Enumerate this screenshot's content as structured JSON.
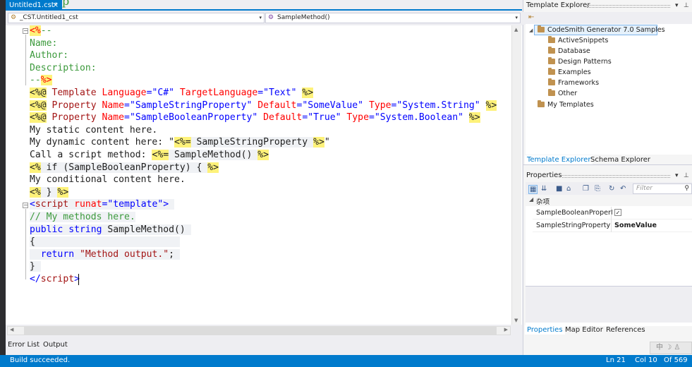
{
  "document_tab": {
    "title": "Untitled1.cst*",
    "close": "×"
  },
  "background_fragment": "p",
  "navbar": {
    "left": {
      "icon": "class-icon",
      "value": "_CST.Untitled1_cst"
    },
    "right": {
      "icon": "method-icon",
      "value": "SampleMethod()"
    },
    "arrow": "▾"
  },
  "code_lines": [
    [
      {
        "t": "<%",
        "c": "hl r"
      },
      {
        "t": "--",
        "c": "g"
      }
    ],
    [
      {
        "t": "Name:",
        "c": "g"
      }
    ],
    [
      {
        "t": "Author:",
        "c": "g"
      }
    ],
    [
      {
        "t": "Description:",
        "c": "g"
      }
    ],
    [
      {
        "t": "--",
        "c": "g"
      },
      {
        "t": "%>",
        "c": "hl r"
      }
    ],
    [
      {
        "t": "<%@",
        "c": "hl t"
      },
      {
        "t": " Template ",
        "c": "m"
      },
      {
        "t": "Language",
        "c": "r"
      },
      {
        "t": "=",
        "c": "b"
      },
      {
        "t": "\"C#\"",
        "c": "b"
      },
      {
        "t": " TargetLanguage",
        "c": "r"
      },
      {
        "t": "=",
        "c": "b"
      },
      {
        "t": "\"Text\"",
        "c": "b"
      },
      {
        "t": " ",
        "c": "t"
      },
      {
        "t": "%>",
        "c": "hl t"
      }
    ],
    [
      {
        "t": "<%@",
        "c": "hl t"
      },
      {
        "t": " Property ",
        "c": "m"
      },
      {
        "t": "Name",
        "c": "r"
      },
      {
        "t": "=",
        "c": "b"
      },
      {
        "t": "\"SampleStringProperty\"",
        "c": "b"
      },
      {
        "t": " Default",
        "c": "r"
      },
      {
        "t": "=",
        "c": "b"
      },
      {
        "t": "\"SomeValue\"",
        "c": "b"
      },
      {
        "t": " Type",
        "c": "r"
      },
      {
        "t": "=",
        "c": "b"
      },
      {
        "t": "\"System.String\"",
        "c": "b"
      },
      {
        "t": " ",
        "c": "t"
      },
      {
        "t": "%>",
        "c": "hl t"
      }
    ],
    [
      {
        "t": "<%@",
        "c": "hl t"
      },
      {
        "t": " Property ",
        "c": "m"
      },
      {
        "t": "Name",
        "c": "r"
      },
      {
        "t": "=",
        "c": "b"
      },
      {
        "t": "\"SampleBooleanProperty\"",
        "c": "b"
      },
      {
        "t": " Default",
        "c": "r"
      },
      {
        "t": "=",
        "c": "b"
      },
      {
        "t": "\"True\"",
        "c": "b"
      },
      {
        "t": " Type",
        "c": "r"
      },
      {
        "t": "=",
        "c": "b"
      },
      {
        "t": "\"System.Boolean\"",
        "c": "b"
      },
      {
        "t": " ",
        "c": "t"
      },
      {
        "t": "%>",
        "c": "hl t"
      }
    ],
    [
      {
        "t": "My static content here.",
        "c": "t"
      }
    ],
    [
      {
        "t": "My dynamic content here: \"",
        "c": "t"
      },
      {
        "t": "<%=",
        "c": "hl t"
      },
      {
        "t": " SampleStringProperty ",
        "c": "t cb"
      },
      {
        "t": "%>",
        "c": "hl t"
      },
      {
        "t": "\"",
        "c": "t"
      }
    ],
    [
      {
        "t": "Call a script method: ",
        "c": "t"
      },
      {
        "t": "<%=",
        "c": "hl t"
      },
      {
        "t": " SampleMethod() ",
        "c": "t cb"
      },
      {
        "t": "%>",
        "c": "hl t"
      }
    ],
    [
      {
        "t": "<%",
        "c": "hl t"
      },
      {
        "t": " if (SampleBooleanProperty) { ",
        "c": "t cb"
      },
      {
        "t": "%>",
        "c": "hl t"
      }
    ],
    [
      {
        "t": "My conditional content here.",
        "c": "t"
      }
    ],
    [
      {
        "t": "<%",
        "c": "hl t"
      },
      {
        "t": " } ",
        "c": "t cb"
      },
      {
        "t": "%>",
        "c": "hl t"
      }
    ],
    [
      {
        "t": "<",
        "c": "b cb"
      },
      {
        "t": "script",
        "c": "m cb"
      },
      {
        "t": " runat",
        "c": "r cb"
      },
      {
        "t": "=",
        "c": "b cb"
      },
      {
        "t": "\"template\"",
        "c": "b cb"
      },
      {
        "t": ">",
        "c": "b cb"
      },
      {
        "t": " ",
        "c": "cb"
      }
    ],
    [
      {
        "t": "// My methods here.",
        "c": "g cb"
      }
    ],
    [
      {
        "t": "public",
        "c": "b cb"
      },
      {
        "t": " ",
        "c": "cb"
      },
      {
        "t": "string",
        "c": "b cb"
      },
      {
        "t": " SampleMethod() ",
        "c": "t cb"
      }
    ],
    [
      {
        "t": "{",
        "c": "t cb"
      },
      {
        "t": "                          ",
        "c": "cb"
      }
    ],
    [
      {
        "t": "  ",
        "c": "cb"
      },
      {
        "t": "return",
        "c": "b cb"
      },
      {
        "t": " ",
        "c": "cb"
      },
      {
        "t": "\"Method output.\"",
        "c": "m cb"
      },
      {
        "t": "; ",
        "c": "t cb"
      }
    ],
    [
      {
        "t": "}",
        "c": "t cb"
      },
      {
        "t": " ",
        "c": "cb"
      }
    ],
    [
      {
        "t": "</",
        "c": "b"
      },
      {
        "t": "script",
        "c": "m"
      },
      {
        "t": ">",
        "c": "b"
      }
    ]
  ],
  "bottom_tabs": [
    "Error List",
    "Output"
  ],
  "status": {
    "message": "Build succeeded.",
    "ln": "Ln 21",
    "col": "Col 10",
    "of": "Of 569"
  },
  "template_explorer": {
    "title": "Template Explorer",
    "header_icons": [
      "▾",
      "⊥"
    ],
    "root": "CodeSmith Generator 7.0 Samples",
    "children": [
      "ActiveSnippets",
      "Database",
      "Design Patterns",
      "Examples",
      "Frameworks",
      "Other"
    ],
    "my_templates": "My Templates",
    "tabs": [
      "Template Explorer",
      "Schema Explorer"
    ]
  },
  "properties": {
    "title": "Properties",
    "filter_placeholder": "Filter",
    "category": "杂项",
    "rows": [
      {
        "name": "SampleBooleanProperty",
        "checked": true
      },
      {
        "name": "SampleStringProperty",
        "value": "SomeValue"
      }
    ],
    "tabs": [
      "Properties",
      "Map Editor",
      "References"
    ]
  },
  "ime": "中 ☽ ♙",
  "colors": {
    "accent": "#007acc",
    "highlight": "#fef27a",
    "comment": "#3c9a3c"
  }
}
